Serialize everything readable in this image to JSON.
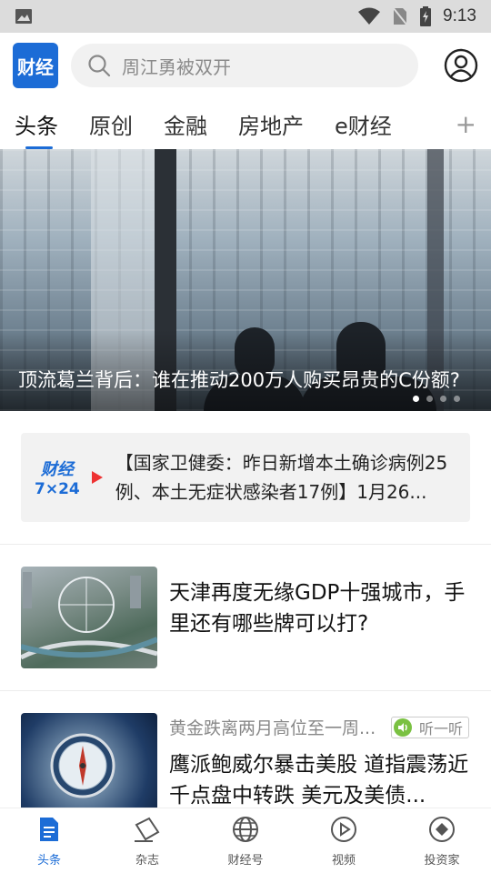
{
  "status_bar": {
    "time": "9:13"
  },
  "header": {
    "logo_text": "财经",
    "search_placeholder": "周江勇被双开"
  },
  "tabs": [
    {
      "label": "头条"
    },
    {
      "label": "原创"
    },
    {
      "label": "金融"
    },
    {
      "label": "房地产"
    },
    {
      "label": "e财经"
    }
  ],
  "banner": {
    "title": "顶流葛兰背后：谁在推动200万人购买昂贵的C份额?",
    "slide_index": 1,
    "slide_count": 4
  },
  "news_724": {
    "badge_top": "财经",
    "badge_bottom": "7×24",
    "text": "【国家卫健委：昨日新增本土确诊病例25例、本土无症状感染者17例】1月26..."
  },
  "articles": [
    {
      "title": "天津再度无缘GDP十强城市，手里还有哪些牌可以打?"
    },
    {
      "subtitle": "黄金跌离两月高位至一周...",
      "listen_label": "听一听",
      "title": "鹰派鲍威尔暴击美股 道指震荡近千点盘中转跌 美元及美债..."
    }
  ],
  "bottom_nav": [
    {
      "label": "头条",
      "icon": "document-icon",
      "active": true
    },
    {
      "label": "杂志",
      "icon": "magazine-icon"
    },
    {
      "label": "财经号",
      "icon": "globe-icon"
    },
    {
      "label": "视频",
      "icon": "play-circle-icon"
    },
    {
      "label": "投资家",
      "icon": "diamond-icon"
    }
  ],
  "colors": {
    "accent": "#1c6cd6",
    "play_red": "#ee3333",
    "listen_green": "#7ac142"
  }
}
